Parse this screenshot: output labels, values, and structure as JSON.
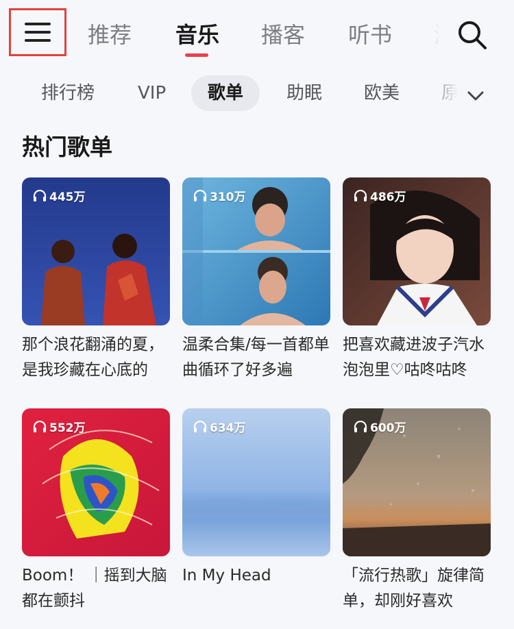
{
  "top_tabs": [
    "推荐",
    "音乐",
    "播客",
    "听书",
    "测"
  ],
  "active_top_tab": "音乐",
  "sub_tabs": [
    "排行榜",
    "VIP",
    "歌单",
    "助眠",
    "欧美",
    "原"
  ],
  "active_sub_tab": "歌单",
  "section_title": "热门歌单",
  "playlists": [
    {
      "plays": "445万",
      "title": "那个浪花翻涌的夏，是我珍藏在心底的",
      "cover": "navy-sky-two-men"
    },
    {
      "plays": "310万",
      "title": "温柔合集/每一首都单曲循环了好多遍",
      "cover": "blue-rainy-portrait"
    },
    {
      "plays": "486万",
      "title": "把喜欢藏进波子汽水泡泡里♡咕咚咕咚",
      "cover": "girl-sailor-collar"
    },
    {
      "plays": "552万",
      "title": "Boom！ ｜摇到大脑都在颤抖",
      "cover": "colorful-painted-face"
    },
    {
      "plays": "634万",
      "title": "In My Head",
      "cover": "pale-blue-gradient"
    },
    {
      "plays": "600万",
      "title": "「流行热歌」旋律简单，却刚好喜欢",
      "cover": "rainy-window-sunset"
    }
  ],
  "icons": {
    "menu": "hamburger-icon",
    "search": "search-icon",
    "expand": "chevron-down-icon",
    "plays": "headphones-icon"
  },
  "colors": {
    "accent": "#ec3e4c",
    "menu_highlight": "#e0423b",
    "background": "#f6f7fb"
  }
}
